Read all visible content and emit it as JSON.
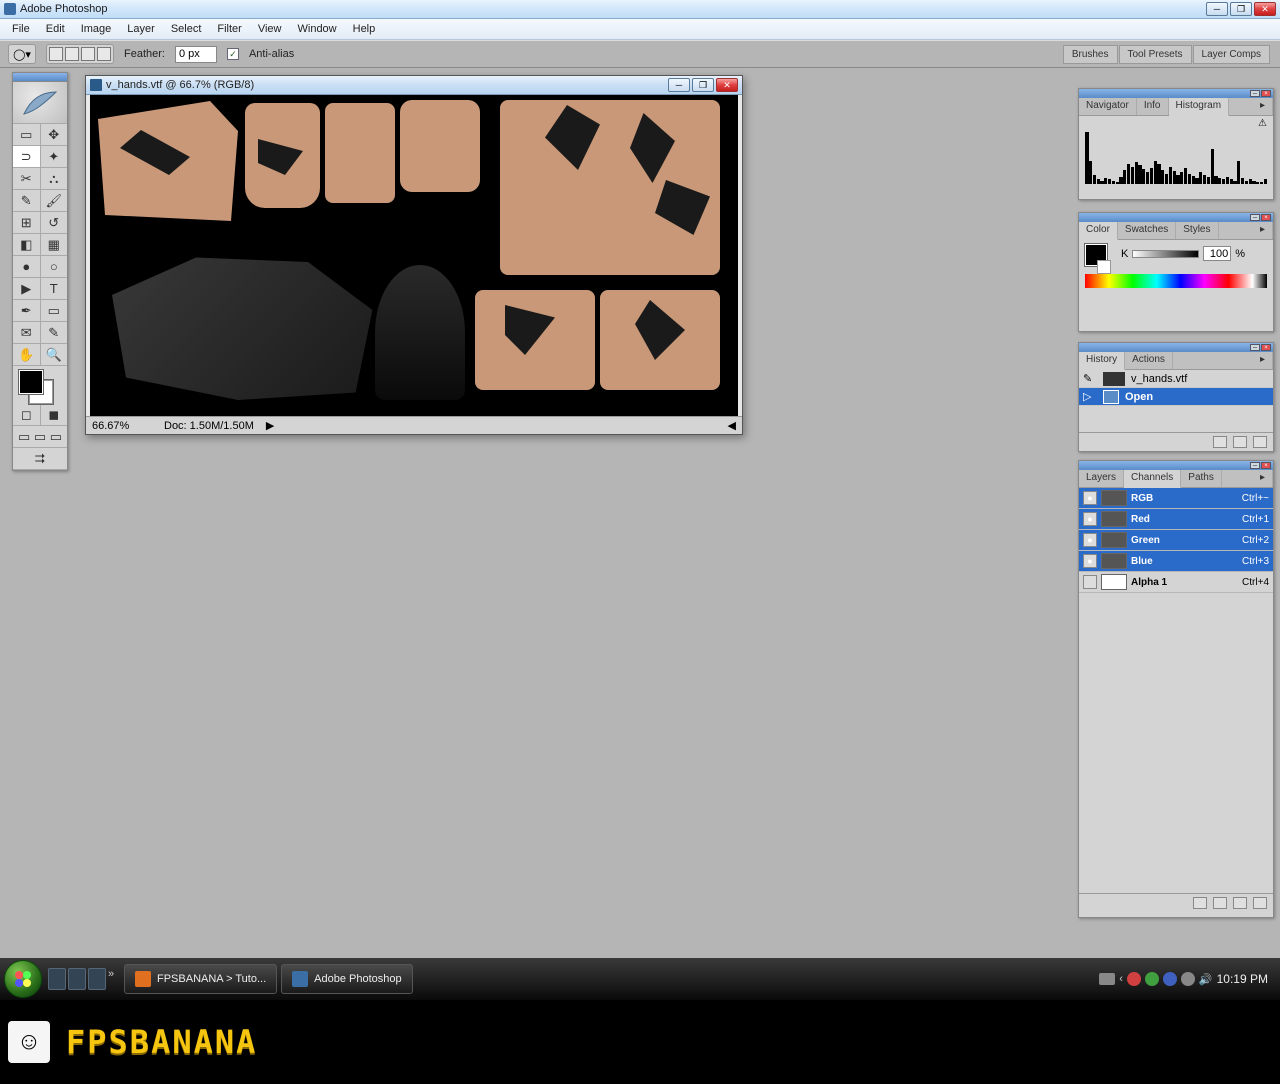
{
  "app": {
    "title": "Adobe Photoshop"
  },
  "menu": [
    "File",
    "Edit",
    "Image",
    "Layer",
    "Select",
    "Filter",
    "View",
    "Window",
    "Help"
  ],
  "options": {
    "feather_label": "Feather:",
    "feather_value": "0 px",
    "antialias": "Anti-alias"
  },
  "dock_tabs": [
    "Brushes",
    "Tool Presets",
    "Layer Comps"
  ],
  "document": {
    "title": "v_hands.vtf @ 66.7% (RGB/8)",
    "zoom": "66.67%",
    "doc_size": "Doc: 1.50M/1.50M"
  },
  "palettes": {
    "nav": {
      "tabs": [
        "Navigator",
        "Info",
        "Histogram"
      ],
      "active": 2
    },
    "color": {
      "tabs": [
        "Color",
        "Swatches",
        "Styles"
      ],
      "active": 0,
      "k_label": "K",
      "k_value": "100",
      "pct": "%"
    },
    "history": {
      "tabs": [
        "History",
        "Actions"
      ],
      "active": 0,
      "file": "v_hands.vtf",
      "step": "Open"
    },
    "channels": {
      "tabs": [
        "Layers",
        "Channels",
        "Paths"
      ],
      "active": 1,
      "rows": [
        {
          "name": "RGB",
          "shortcut": "Ctrl+~",
          "sel": true,
          "eye": true
        },
        {
          "name": "Red",
          "shortcut": "Ctrl+1",
          "sel": true,
          "eye": true
        },
        {
          "name": "Green",
          "shortcut": "Ctrl+2",
          "sel": true,
          "eye": true
        },
        {
          "name": "Blue",
          "shortcut": "Ctrl+3",
          "sel": true,
          "eye": true
        },
        {
          "name": "Alpha 1",
          "shortcut": "Ctrl+4",
          "sel": false,
          "eye": false
        }
      ]
    }
  },
  "taskbar": {
    "items": [
      {
        "label": "FPSBANANA > Tuto..."
      },
      {
        "label": "Adobe Photoshop"
      }
    ],
    "clock": "10:19 PM"
  },
  "footer": {
    "brand": "FPSBANANA"
  }
}
